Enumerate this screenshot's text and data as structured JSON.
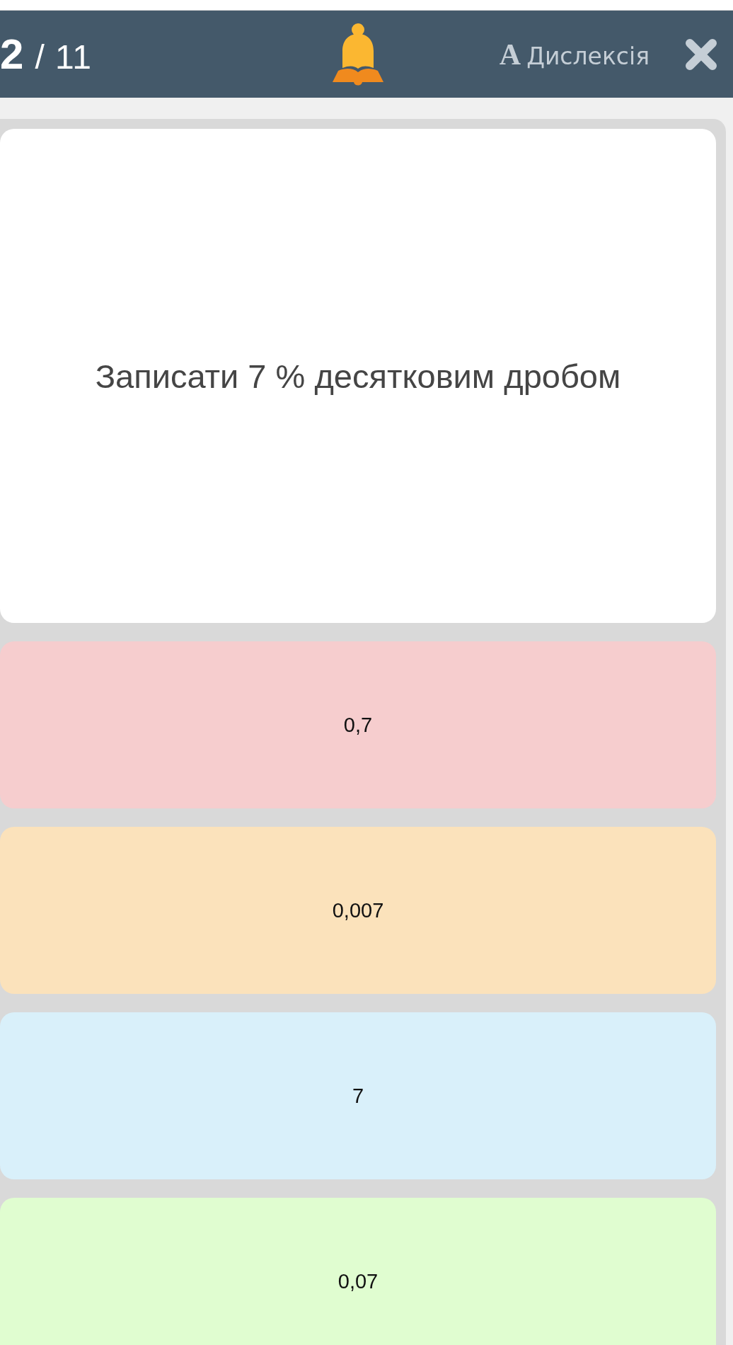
{
  "header": {
    "progress": {
      "current": "2",
      "total": "/ 11"
    },
    "dyslexia_toggle": {
      "letter": "A",
      "label": "Дислексія"
    }
  },
  "question": {
    "text": "Записати 7 % десятковим дробом"
  },
  "answers": [
    {
      "text": "0,7",
      "color": "#f6cdce"
    },
    {
      "text": "0,007",
      "color": "#fbe2bb"
    },
    {
      "text": "7",
      "color": "#d9f0fa"
    },
    {
      "text": "0,07",
      "color": "#e0fdd0"
    }
  ]
}
